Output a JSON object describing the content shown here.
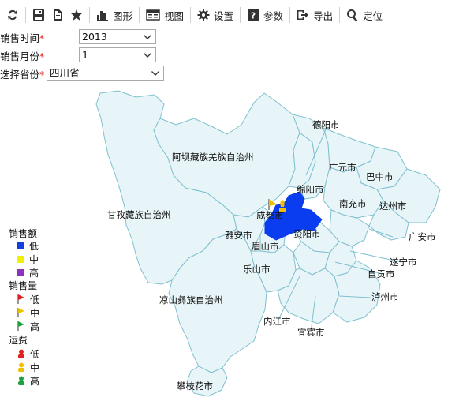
{
  "toolbar": {
    "chart_label": "图形",
    "view_label": "视图",
    "settings_label": "设置",
    "params_label": "参数",
    "export_label": "导出",
    "locate_label": "定位"
  },
  "filters": {
    "year": {
      "label": "销售时间",
      "required_mark": "*",
      "value": "2013"
    },
    "month": {
      "label": "销售月份",
      "required_mark": "*",
      "value": "1"
    },
    "province": {
      "label": "选择省份",
      "required_mark": "*",
      "value": "四川省"
    }
  },
  "map": {
    "highlight_color": "#0a3cf0",
    "region_fill": "#e8f5f8",
    "border_color": "#7fc0cf",
    "highlighted_region": "成都市",
    "cities": [
      "德阳市",
      "阿坝藏族羌族自治州",
      "广元市",
      "巴中市",
      "绵阳市",
      "甘孜藏族自治州",
      "南充市",
      "达州市",
      "成都市",
      "雅安市",
      "资阳市",
      "广安市",
      "眉山市",
      "遂宁市",
      "乐山市",
      "自贡市",
      "凉山彝族自治州",
      "泸州市",
      "内江市",
      "宜宾市",
      "攀枝花市"
    ]
  },
  "legend": {
    "sales_amount": {
      "title": "销售额",
      "items": [
        {
          "label": "低",
          "color": "#1040e0"
        },
        {
          "label": "中",
          "color": "#f0f000"
        },
        {
          "label": "高",
          "color": "#9030c0"
        }
      ]
    },
    "sales_volume": {
      "title": "销售量",
      "items": [
        {
          "label": "低",
          "color": "#e02020"
        },
        {
          "label": "中",
          "color": "#f0c000"
        },
        {
          "label": "高",
          "color": "#20a040"
        }
      ]
    },
    "freight": {
      "title": "运费",
      "items": [
        {
          "label": "低",
          "color": "#e02020"
        },
        {
          "label": "中",
          "color": "#f0c000"
        },
        {
          "label": "高",
          "color": "#20a040"
        }
      ]
    }
  }
}
